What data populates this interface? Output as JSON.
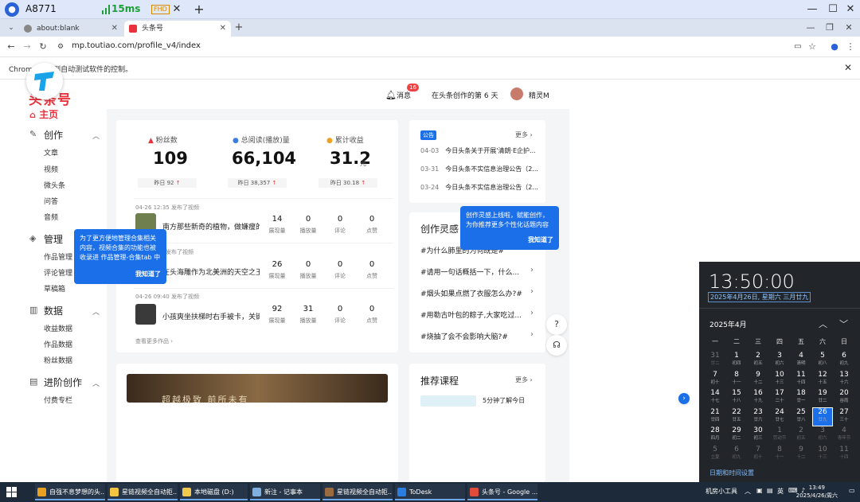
{
  "remote": {
    "session_id": "A8771",
    "latency": "15ms",
    "quality": "FHD"
  },
  "browser": {
    "tabs": [
      {
        "label": "about:blank"
      },
      {
        "label": "头条号"
      }
    ],
    "url": "mp.toutiao.com/profile_v4/index",
    "infobar": "Chrome 正受到自动测试软件的控制。"
  },
  "header": {
    "logo_text": "头条号",
    "messages_label": "消息",
    "messages_badge": "16",
    "days_text": "在头条创作的第 6 天",
    "username": "精灵M"
  },
  "sidebar": {
    "home": "主页",
    "groups": [
      {
        "label": "创作",
        "items": [
          "文章",
          "视频",
          "微头条",
          "问答",
          "音频"
        ]
      },
      {
        "label": "管理",
        "items": [
          "作品管理",
          "评论管理",
          "草稿箱"
        ]
      },
      {
        "label": "数据",
        "items": [
          "收益数据",
          "作品数据",
          "粉丝数据"
        ]
      },
      {
        "label": "进阶创作",
        "items": [
          "付费专栏"
        ]
      }
    ]
  },
  "stats": [
    {
      "label": "粉丝数",
      "value": "109",
      "sub": "昨日 92",
      "color": "#e8323c"
    },
    {
      "label": "总阅读(播放)量",
      "value": "66,104",
      "sub": "昨日 38,357",
      "color": "#3b7ddd"
    },
    {
      "label": "累计收益",
      "value": "31.2",
      "unit": "元",
      "sub": "昨日 30.18",
      "color": "#f0a020"
    }
  ],
  "feed": [
    {
      "date": "04-26 12:35  发布了视频",
      "title": "南方那些新奇的植物，做嫌瘦的...",
      "views": "14",
      "plays": "0",
      "comments": "0",
      "likes": "0"
    },
    {
      "date": "发布了视频",
      "title": "在头海雕作为北美洲的天空之王...",
      "views": "26",
      "plays": "0",
      "comments": "0",
      "likes": "0"
    },
    {
      "date": "04-26 09:40  发布了视频",
      "title": "小孩爽坐扶梯时右手被卡，关键...",
      "views": "92",
      "plays": "31",
      "comments": "0",
      "likes": "0"
    }
  ],
  "feed_labels": {
    "views": "展现量",
    "plays": "播放量",
    "comments": "评论",
    "likes": "点赞"
  },
  "more_works": "查看更多作品",
  "notice": {
    "tag": "公告",
    "more": "更多",
    "rows": [
      {
        "date": "04-03",
        "text": "今日头条关于开展'清朗·E企护..."
      },
      {
        "date": "03-31",
        "text": "今日头条不实信息治理公告（2..."
      },
      {
        "date": "03-24",
        "text": "今日头条不实信息治理公告（2..."
      }
    ]
  },
  "inspiration": {
    "title": "创作灵感",
    "rows": [
      "#为什么肺里的为何既是#",
      "#请用一句话概括一下，什么...",
      "#烟头如果点燃了衣服怎么办?#",
      "#用勒古叶包的粽子,大家吃过...",
      "#烧抽了会不会影响大脑?#"
    ]
  },
  "course": {
    "title": "推荐课程",
    "more": "更多",
    "item": "5分钟了解今日"
  },
  "banner_text": "超越极致 前所未有",
  "tooltips": {
    "manage": "为了更方便地管理合集相关内容，视频合集的功能也被收录进 作品管理-合集tab 中",
    "manage_ok": "我知道了",
    "inspire": "创作灵感上线啦，赋能创作，为你推荐更多个性化话题内容",
    "inspire_ok": "我知道了"
  },
  "calendar": {
    "time": "13:50:00",
    "date": "2025年4月26日, 星期六 三月廿九",
    "month": "2025年4月",
    "weekdays": [
      "一",
      "二",
      "三",
      "四",
      "五",
      "六",
      "日"
    ],
    "weeks": [
      [
        [
          "31",
          "廿二",
          1
        ],
        [
          "1",
          "初四",
          0
        ],
        [
          "2",
          "初五",
          0
        ],
        [
          "3",
          "初六",
          0
        ],
        [
          "4",
          "清明",
          0
        ],
        [
          "5",
          "初八",
          0
        ],
        [
          "6",
          "初九",
          0
        ]
      ],
      [
        [
          "7",
          "初十",
          0
        ],
        [
          "8",
          "十一",
          0
        ],
        [
          "9",
          "十二",
          0
        ],
        [
          "10",
          "十三",
          0
        ],
        [
          "11",
          "十四",
          0
        ],
        [
          "12",
          "十五",
          0
        ],
        [
          "13",
          "十六",
          0
        ]
      ],
      [
        [
          "14",
          "十七",
          0
        ],
        [
          "15",
          "十八",
          0
        ],
        [
          "16",
          "十九",
          0
        ],
        [
          "17",
          "二十",
          0
        ],
        [
          "18",
          "廿一",
          0
        ],
        [
          "19",
          "廿二",
          0
        ],
        [
          "20",
          "谷雨",
          0
        ]
      ],
      [
        [
          "21",
          "廿四",
          0
        ],
        [
          "22",
          "廿五",
          0
        ],
        [
          "23",
          "廿六",
          0
        ],
        [
          "24",
          "廿七",
          0
        ],
        [
          "25",
          "廿八",
          0
        ],
        [
          "26",
          "廿九",
          2
        ],
        [
          "27",
          "三十",
          0
        ]
      ],
      [
        [
          "28",
          "四月",
          0
        ],
        [
          "29",
          "初二",
          0
        ],
        [
          "30",
          "初三",
          0
        ],
        [
          "1",
          "劳动节",
          1
        ],
        [
          "2",
          "初五",
          1
        ],
        [
          "3",
          "初六",
          1
        ],
        [
          "4",
          "青年节",
          1
        ]
      ],
      [
        [
          "5",
          "立夏",
          1
        ],
        [
          "6",
          "初九",
          1
        ],
        [
          "7",
          "初十",
          1
        ],
        [
          "8",
          "十一",
          1
        ],
        [
          "9",
          "十二",
          1
        ],
        [
          "10",
          "十三",
          1
        ],
        [
          "11",
          "十四",
          1
        ]
      ]
    ],
    "settings_link": "日期和时间设置"
  },
  "taskbar": {
    "items": [
      {
        "label": "自强不息梦想的头...",
        "color": "#e8a020"
      },
      {
        "label": "星链视频全自动拒...",
        "color": "#f4c542"
      },
      {
        "label": "本地磁盘 (D:)",
        "color": "#f2c94c"
      },
      {
        "label": "新注 - 记事本",
        "color": "#7fb0e0"
      },
      {
        "label": "星链视频全自动拒...",
        "color": "#9a6b3f"
      },
      {
        "label": "ToDesk",
        "color": "#2a7de1"
      },
      {
        "label": "头条号 - Google ...",
        "color": "#e04c3c"
      }
    ],
    "tray_label": "机房小工具",
    "ime": "英",
    "time": "13:49",
    "date": "2025/4/26/周六"
  }
}
